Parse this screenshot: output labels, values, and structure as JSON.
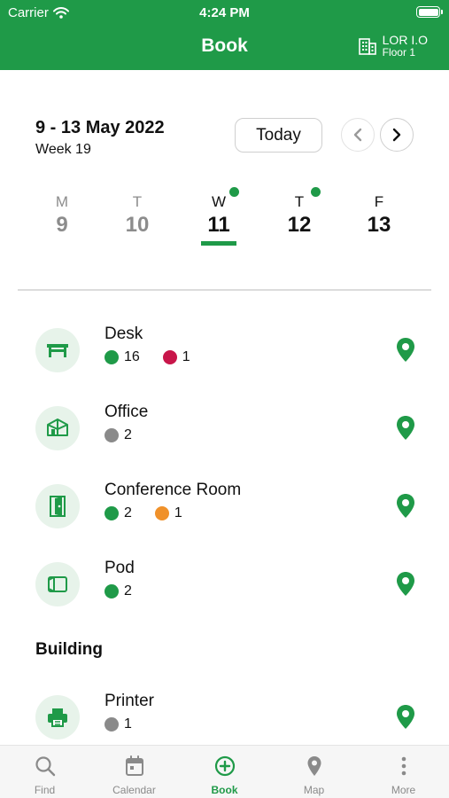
{
  "status_bar": {
    "carrier": "Carrier",
    "time": "4:24 PM"
  },
  "nav": {
    "title": "Book",
    "location_name": "LOR I.O",
    "location_floor": "Floor 1"
  },
  "calendar": {
    "range_label": "9 - 13 May 2022",
    "week_label": "Week 19",
    "today_label": "Today",
    "days": [
      {
        "letter": "M",
        "date": "9",
        "state": "past",
        "has_booking": false
      },
      {
        "letter": "T",
        "date": "10",
        "state": "past",
        "has_booking": false
      },
      {
        "letter": "W",
        "date": "11",
        "state": "selected",
        "has_booking": true
      },
      {
        "letter": "T",
        "date": "12",
        "state": "future",
        "has_booking": true
      },
      {
        "letter": "F",
        "date": "13",
        "state": "future",
        "has_booking": false
      }
    ]
  },
  "resources": [
    {
      "name": "Desk",
      "icon": "desk-icon",
      "counts": [
        {
          "value": "16",
          "color": "#1f9a48"
        },
        {
          "value": "1",
          "color": "#c8164a"
        }
      ]
    },
    {
      "name": "Office",
      "icon": "office-icon",
      "counts": [
        {
          "value": "2",
          "color": "#8a8a8a"
        }
      ]
    },
    {
      "name": "Conference Room",
      "icon": "conference-room-icon",
      "counts": [
        {
          "value": "2",
          "color": "#1f9a48"
        },
        {
          "value": "1",
          "color": "#f0912a"
        }
      ]
    },
    {
      "name": "Pod",
      "icon": "pod-icon",
      "counts": [
        {
          "value": "2",
          "color": "#1f9a48"
        }
      ]
    }
  ],
  "building_section": {
    "title": "Building",
    "items": [
      {
        "name": "Printer",
        "icon": "printer-icon",
        "counts": [
          {
            "value": "1",
            "color": "#8a8a8a"
          }
        ]
      }
    ]
  },
  "tabs": [
    {
      "label": "Find",
      "icon": "search-icon",
      "active": false
    },
    {
      "label": "Calendar",
      "icon": "calendar-icon",
      "active": false
    },
    {
      "label": "Book",
      "icon": "book-plus-icon",
      "active": true
    },
    {
      "label": "Map",
      "icon": "map-pin-icon",
      "active": false
    },
    {
      "label": "More",
      "icon": "more-icon",
      "active": false
    }
  ],
  "colors": {
    "brand_green": "#1f9a48",
    "badge_bg": "#e7f3ea",
    "inactive_gray": "#8a8a8a"
  }
}
